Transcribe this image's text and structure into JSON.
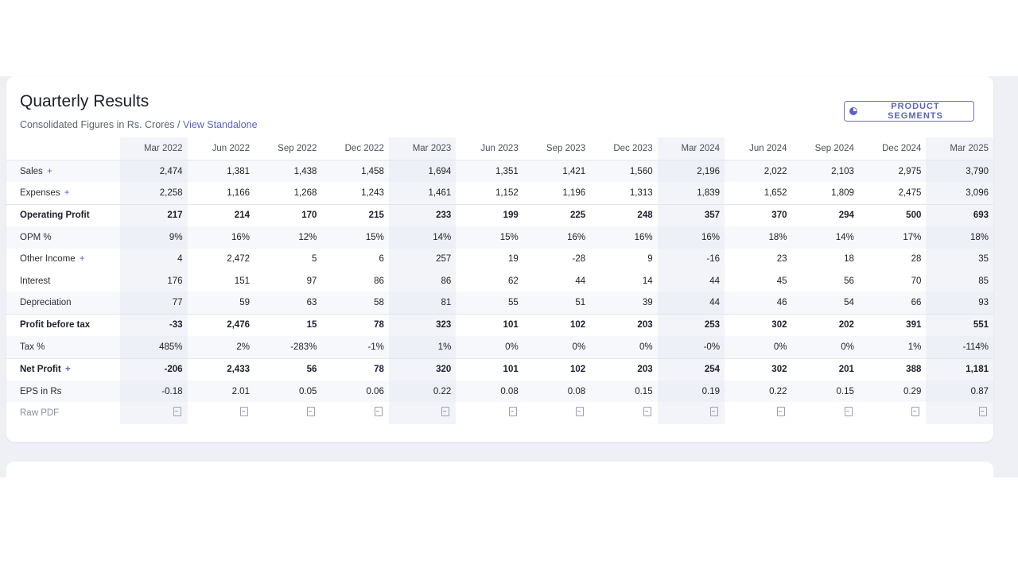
{
  "section": {
    "title": "Quarterly Results",
    "subtitle_prefix": "Consolidated Figures in Rs. Crores / ",
    "subtitle_link": "View Standalone",
    "segments_button": "PRODUCT SEGMENTS"
  },
  "table": {
    "columns": [
      "Mar 2022",
      "Jun 2022",
      "Sep 2022",
      "Dec 2022",
      "Mar 2023",
      "Jun 2023",
      "Sep 2023",
      "Dec 2023",
      "Mar 2024",
      "Jun 2024",
      "Sep 2024",
      "Dec 2024",
      "Mar 2025"
    ],
    "rows": [
      {
        "label": "Sales",
        "plus": "+",
        "values": [
          "2,474",
          "1,381",
          "1,438",
          "1,458",
          "1,694",
          "1,351",
          "1,421",
          "1,560",
          "2,196",
          "2,022",
          "2,103",
          "2,975",
          "3,790"
        ]
      },
      {
        "label": "Expenses",
        "plus": "+",
        "values": [
          "2,258",
          "1,166",
          "1,268",
          "1,243",
          "1,461",
          "1,152",
          "1,196",
          "1,313",
          "1,839",
          "1,652",
          "1,809",
          "2,475",
          "3,096"
        ]
      },
      {
        "label": "Operating Profit",
        "plus": "",
        "values": [
          "217",
          "214",
          "170",
          "215",
          "233",
          "199",
          "225",
          "248",
          "357",
          "370",
          "294",
          "500",
          "693"
        ]
      },
      {
        "label": "OPM %",
        "plus": "",
        "values": [
          "9%",
          "16%",
          "12%",
          "15%",
          "14%",
          "15%",
          "16%",
          "16%",
          "16%",
          "18%",
          "14%",
          "17%",
          "18%"
        ]
      },
      {
        "label": "Other Income",
        "plus": "+",
        "values": [
          "4",
          "2,472",
          "5",
          "6",
          "257",
          "19",
          "-28",
          "9",
          "-16",
          "23",
          "18",
          "28",
          "35"
        ]
      },
      {
        "label": "Interest",
        "plus": "",
        "values": [
          "176",
          "151",
          "97",
          "86",
          "86",
          "62",
          "44",
          "14",
          "44",
          "45",
          "56",
          "70",
          "85"
        ]
      },
      {
        "label": "Depreciation",
        "plus": "",
        "values": [
          "77",
          "59",
          "63",
          "58",
          "81",
          "55",
          "51",
          "39",
          "44",
          "46",
          "54",
          "66",
          "93"
        ]
      },
      {
        "label": "Profit before tax",
        "plus": "",
        "values": [
          "-33",
          "2,476",
          "15",
          "78",
          "323",
          "101",
          "102",
          "203",
          "253",
          "302",
          "202",
          "391",
          "551"
        ]
      },
      {
        "label": "Tax %",
        "plus": "",
        "values": [
          "485%",
          "2%",
          "-283%",
          "-1%",
          "1%",
          "0%",
          "0%",
          "0%",
          "-0%",
          "0%",
          "0%",
          "1%",
          "-114%"
        ]
      },
      {
        "label": "Net Profit",
        "plus": "+",
        "values": [
          "-206",
          "2,433",
          "56",
          "78",
          "320",
          "101",
          "102",
          "203",
          "254",
          "302",
          "201",
          "388",
          "1,181"
        ]
      },
      {
        "label": "EPS in Rs",
        "plus": "",
        "values": [
          "-0.18",
          "2.01",
          "0.05",
          "0.06",
          "0.22",
          "0.08",
          "0.08",
          "0.15",
          "0.19",
          "0.22",
          "0.15",
          "0.29",
          "0.87"
        ]
      }
    ],
    "pdf_row_label": "Raw PDF",
    "pdf_icon": "pdf-file-icon"
  }
}
